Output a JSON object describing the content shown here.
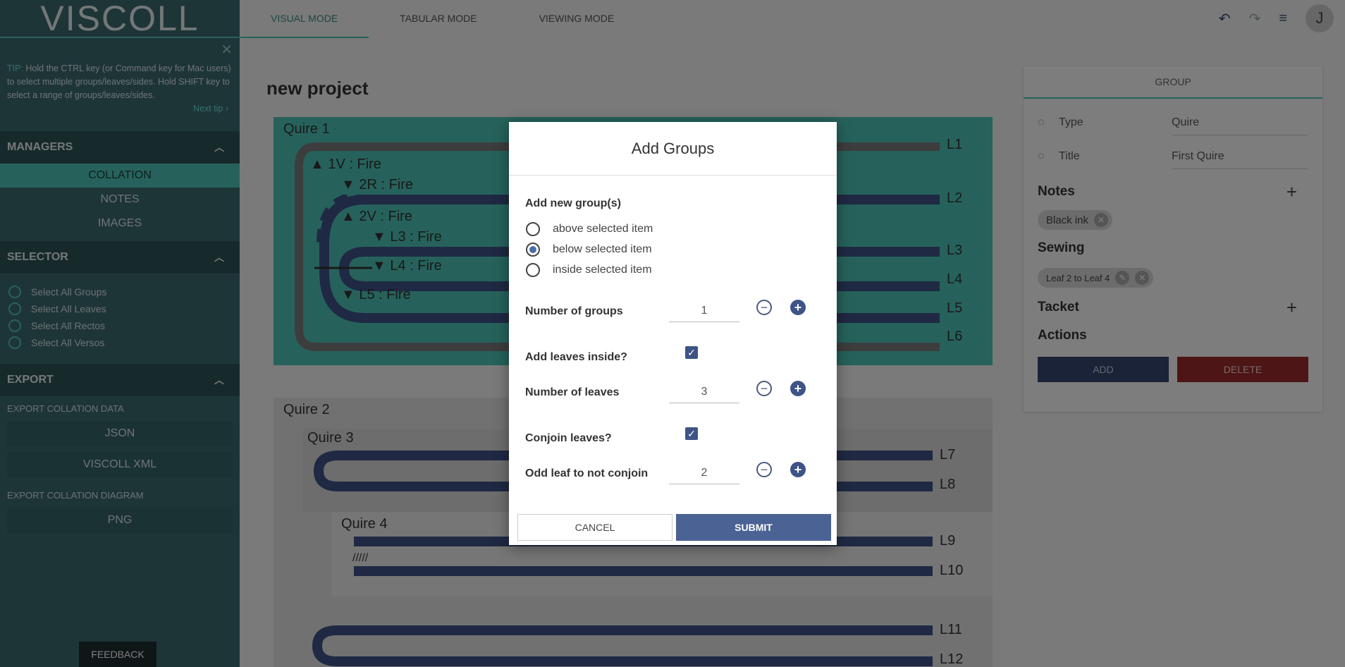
{
  "sidebar": {
    "logo": "VISCOLL",
    "tip": {
      "prefix": "TIP:",
      "text": "Hold the CTRL key (or Command key for Mac users) to select multiple groups/leaves/sides. Hold SHIFT key to select a range of groups/leaves/sides.",
      "next": "Next tip ›"
    },
    "managers": {
      "title": "MANAGERS",
      "items": [
        "COLLATION",
        "NOTES",
        "IMAGES"
      ]
    },
    "selector": {
      "title": "SELECTOR",
      "items": [
        "Select All Groups",
        "Select All Leaves",
        "Select All Rectos",
        "Select All Versos"
      ]
    },
    "export": {
      "title": "EXPORT",
      "data_label": "EXPORT COLLATION DATA",
      "json": "JSON",
      "xml": "VISCOLL XML",
      "diagram_label": "EXPORT COLLATION DIAGRAM",
      "png": "PNG"
    },
    "feedback": "FEEDBACK"
  },
  "topbar": {
    "tabs": [
      "VISUAL MODE",
      "TABULAR MODE",
      "VIEWING MODE"
    ],
    "avatar": "J"
  },
  "main": {
    "project_title": "new project",
    "quires": {
      "q1": "Quire 1",
      "q2": "Quire 2",
      "q3": "Quire 3",
      "q4": "Quire 4"
    },
    "leaf_tags": [
      "▲ 1V : Fire",
      "▼ 2R : Fire",
      "▲ 2V : Fire",
      "▼ L3 : Fire",
      "▼ L4 : Fire",
      "▼ L5 : Fire"
    ],
    "leaves": [
      "L1",
      "L2",
      "L3",
      "L4",
      "L5",
      "L6",
      "L7",
      "L8",
      "L9",
      "L10",
      "L11",
      "L12"
    ]
  },
  "panel": {
    "header": "GROUP",
    "type_label": "Type",
    "type_value": "Quire",
    "title_label": "Title",
    "title_value": "First Quire",
    "notes": "Notes",
    "note_chip": "Black ink",
    "sewing": "Sewing",
    "sewing_chip": "Leaf 2 to Leaf 4",
    "tacket": "Tacket",
    "actions": "Actions",
    "add": "ADD",
    "delete": "DELETE"
  },
  "modal": {
    "title": "Add Groups",
    "add_new": "Add new group(s)",
    "options": [
      "above selected item",
      "below selected item",
      "inside selected item"
    ],
    "selected_option": 1,
    "num_groups_label": "Number of groups",
    "num_groups": "1",
    "add_leaves_label": "Add leaves inside?",
    "num_leaves_label": "Number of leaves",
    "num_leaves": "3",
    "conjoin_label": "Conjoin leaves?",
    "odd_leaf_label": "Odd leaf to not conjoin",
    "odd_leaf": "2",
    "cancel": "CANCEL",
    "submit": "SUBMIT"
  }
}
